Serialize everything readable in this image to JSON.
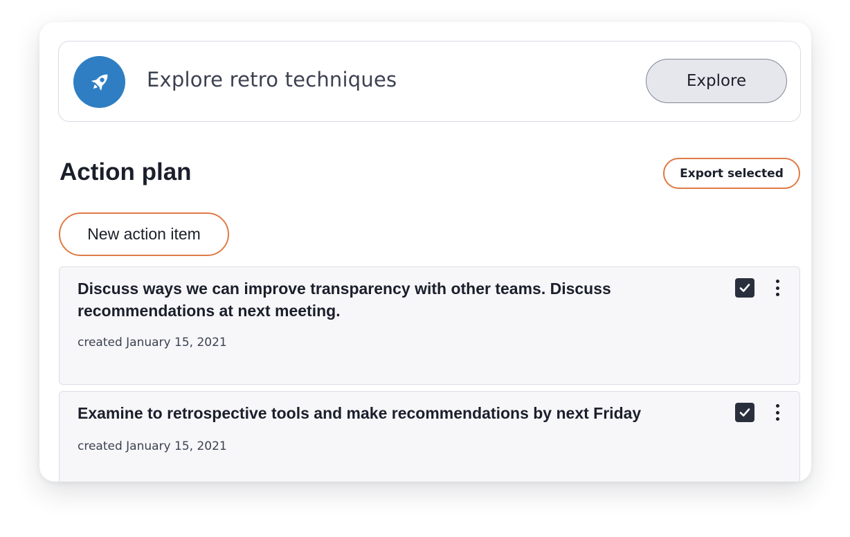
{
  "explore": {
    "icon": "rocket-icon",
    "text": "Explore retro techniques",
    "button_label": "Explore",
    "accent_color": "#2f7ec3"
  },
  "action_plan": {
    "title": "Action plan",
    "export_label": "Export selected",
    "new_item_label": "New action item",
    "button_border_color": "#e07a45",
    "items": [
      {
        "text": "Discuss ways we can improve transparency with other teams. Discuss recommendations at next meeting.",
        "created": "created January 15, 2021",
        "checked": true,
        "menu_icon": "more-vertical-icon"
      },
      {
        "text": "Examine to retrospective tools and make recommendations by next Friday",
        "created": "created January 15, 2021",
        "checked": true,
        "menu_icon": "more-vertical-icon"
      }
    ]
  }
}
